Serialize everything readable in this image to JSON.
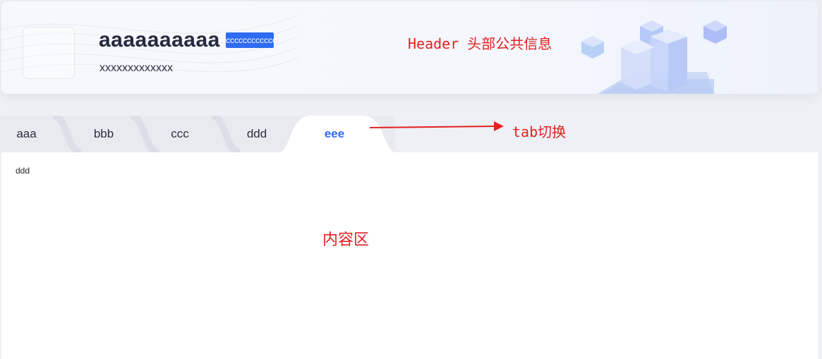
{
  "header": {
    "title": "aaaaaaaaaa",
    "badge": "cccccccccccc",
    "subtitle": "xxxxxxxxxxxxx"
  },
  "annotations": {
    "header": "Header 头部公共信息",
    "tab": "tab切换",
    "content": "内容区"
  },
  "tabs": [
    {
      "label": "aaa",
      "active": false
    },
    {
      "label": "bbb",
      "active": false
    },
    {
      "label": "ccc",
      "active": false
    },
    {
      "label": "ddd",
      "active": false
    },
    {
      "label": "eee",
      "active": true
    }
  ],
  "content": {
    "text": "ddd"
  },
  "colors": {
    "accent": "#2f6bf2",
    "annotation": "#e52020",
    "title": "#252a40"
  }
}
